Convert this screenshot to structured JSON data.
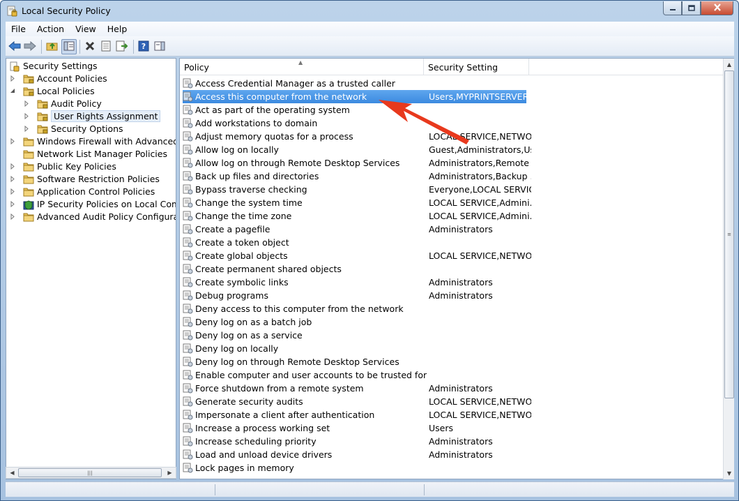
{
  "window": {
    "title": "Local Security Policy"
  },
  "menubar": [
    "File",
    "Action",
    "View",
    "Help"
  ],
  "tree": {
    "root": "Security Settings",
    "items": [
      {
        "label": "Account Policies",
        "level": 1,
        "expander": "right"
      },
      {
        "label": "Local Policies",
        "level": 1,
        "expander": "down"
      },
      {
        "label": "Audit Policy",
        "level": 2,
        "expander": "right"
      },
      {
        "label": "User Rights Assignment",
        "level": 2,
        "expander": "right",
        "selected": true
      },
      {
        "label": "Security Options",
        "level": 2,
        "expander": "right"
      },
      {
        "label": "Windows Firewall with Advanced Secu",
        "level": 1,
        "expander": "right"
      },
      {
        "label": "Network List Manager Policies",
        "level": 1,
        "expander": "none"
      },
      {
        "label": "Public Key Policies",
        "level": 1,
        "expander": "right"
      },
      {
        "label": "Software Restriction Policies",
        "level": 1,
        "expander": "right"
      },
      {
        "label": "Application Control Policies",
        "level": 1,
        "expander": "right"
      },
      {
        "label": "IP Security Policies on Local Compute",
        "level": 1,
        "expander": "right",
        "shield": true
      },
      {
        "label": "Advanced Audit Policy Configuration",
        "level": 1,
        "expander": "right"
      }
    ]
  },
  "list": {
    "columns": {
      "policy": "Policy",
      "setting": "Security Setting"
    },
    "rows": [
      {
        "policy": "Access Credential Manager as a trusted caller",
        "setting": ""
      },
      {
        "policy": "Access this computer from the network",
        "setting": "Users,MYPRINTSERVER\\...",
        "selected": true
      },
      {
        "policy": "Act as part of the operating system",
        "setting": ""
      },
      {
        "policy": "Add workstations to domain",
        "setting": ""
      },
      {
        "policy": "Adjust memory quotas for a process",
        "setting": "LOCAL SERVICE,NETWO..."
      },
      {
        "policy": "Allow log on locally",
        "setting": "Guest,Administrators,Us..."
      },
      {
        "policy": "Allow log on through Remote Desktop Services",
        "setting": "Administrators,Remote ..."
      },
      {
        "policy": "Back up files and directories",
        "setting": "Administrators,Backup ..."
      },
      {
        "policy": "Bypass traverse checking",
        "setting": "Everyone,LOCAL SERVIC..."
      },
      {
        "policy": "Change the system time",
        "setting": "LOCAL SERVICE,Admini..."
      },
      {
        "policy": "Change the time zone",
        "setting": "LOCAL SERVICE,Admini..."
      },
      {
        "policy": "Create a pagefile",
        "setting": "Administrators"
      },
      {
        "policy": "Create a token object",
        "setting": ""
      },
      {
        "policy": "Create global objects",
        "setting": "LOCAL SERVICE,NETWO..."
      },
      {
        "policy": "Create permanent shared objects",
        "setting": ""
      },
      {
        "policy": "Create symbolic links",
        "setting": "Administrators"
      },
      {
        "policy": "Debug programs",
        "setting": "Administrators"
      },
      {
        "policy": "Deny access to this computer from the network",
        "setting": ""
      },
      {
        "policy": "Deny log on as a batch job",
        "setting": ""
      },
      {
        "policy": "Deny log on as a service",
        "setting": ""
      },
      {
        "policy": "Deny log on locally",
        "setting": ""
      },
      {
        "policy": "Deny log on through Remote Desktop Services",
        "setting": ""
      },
      {
        "policy": "Enable computer and user accounts to be trusted for delega...",
        "setting": ""
      },
      {
        "policy": "Force shutdown from a remote system",
        "setting": "Administrators"
      },
      {
        "policy": "Generate security audits",
        "setting": "LOCAL SERVICE,NETWO..."
      },
      {
        "policy": "Impersonate a client after authentication",
        "setting": "LOCAL SERVICE,NETWO..."
      },
      {
        "policy": "Increase a process working set",
        "setting": "Users"
      },
      {
        "policy": "Increase scheduling priority",
        "setting": "Administrators"
      },
      {
        "policy": "Load and unload device drivers",
        "setting": "Administrators"
      },
      {
        "policy": "Lock pages in memory",
        "setting": ""
      }
    ]
  },
  "annotation": {
    "color": "#e8391d"
  },
  "colors": {
    "selection": "#3b8ae0",
    "folder": "#e9c25a"
  }
}
